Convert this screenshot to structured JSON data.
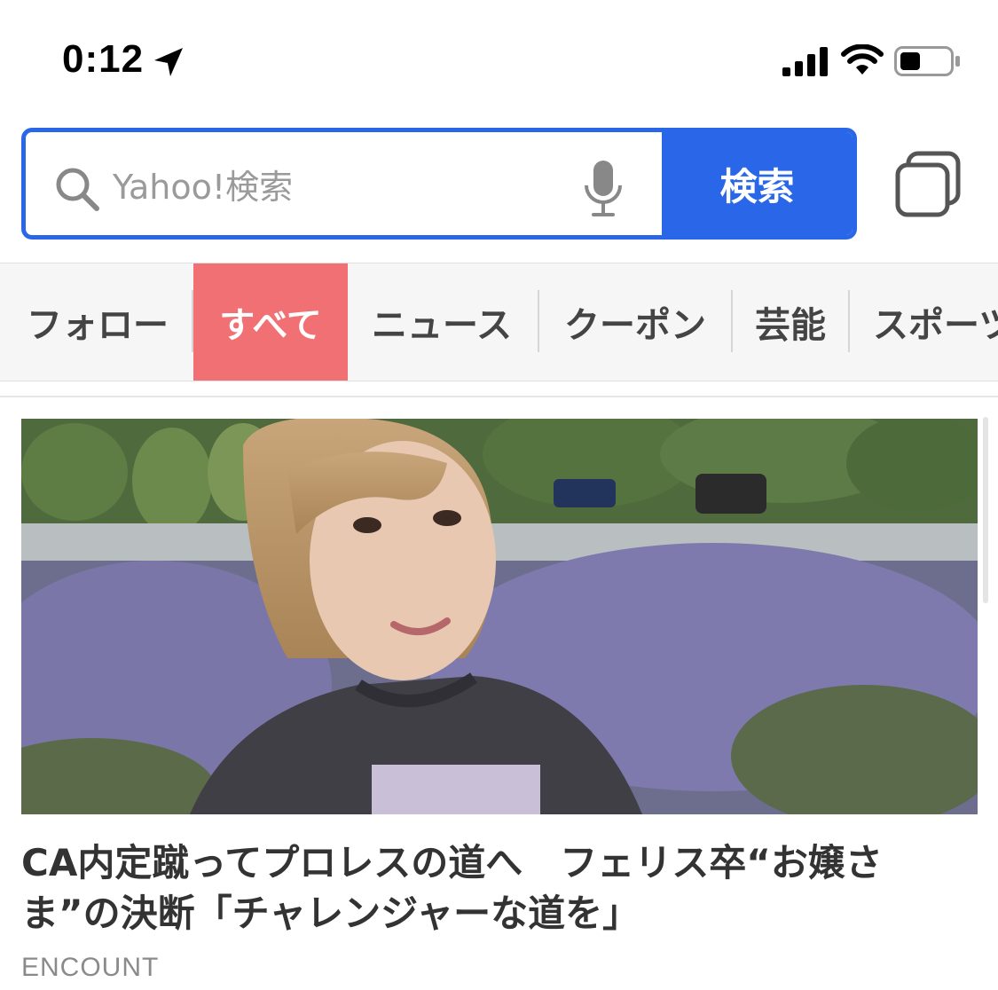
{
  "status_bar": {
    "time": "0:12"
  },
  "search": {
    "placeholder": "Yahoo!検索",
    "button_label": "検索"
  },
  "categories": [
    {
      "label": "フォロー",
      "active": false
    },
    {
      "label": "すべて",
      "active": true
    },
    {
      "label": "ニュース",
      "active": false
    },
    {
      "label": "クーポン",
      "active": false
    },
    {
      "label": "芸能",
      "active": false
    },
    {
      "label": "スポーツ",
      "active": false
    }
  ],
  "article": {
    "title": "CA内定蹴ってプロレスの道へ　フェリス卒“お嬢さま”の決断「チャレンジャーな道を」",
    "source": "ENCOUNT"
  },
  "colors": {
    "accent_blue": "#2a67e8",
    "active_tab": "#f07074"
  }
}
